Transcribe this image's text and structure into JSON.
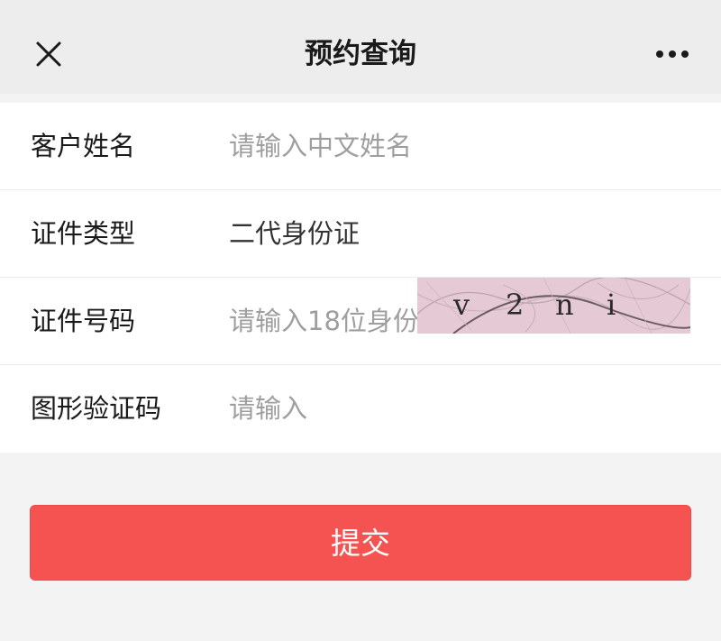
{
  "header": {
    "title": "预约查询",
    "close_icon": "close-icon",
    "more_icon": "more-dots-icon"
  },
  "form": {
    "rows": [
      {
        "label": "客户姓名",
        "placeholder": "请输入中文姓名"
      },
      {
        "label": "证件类型",
        "value": "二代身份证"
      },
      {
        "label": "证件号码",
        "placeholder": "请输入18位身份证"
      },
      {
        "label": "图形验证码",
        "placeholder": "请输入"
      }
    ],
    "captcha": {
      "chars": [
        "v",
        "2",
        "n",
        "i"
      ],
      "background_color": "#e5c9d5"
    }
  },
  "submit_label": "提交",
  "colors": {
    "accent": "#f55352",
    "page_background": "#f3f3f3",
    "nav_background": "#ededed"
  }
}
